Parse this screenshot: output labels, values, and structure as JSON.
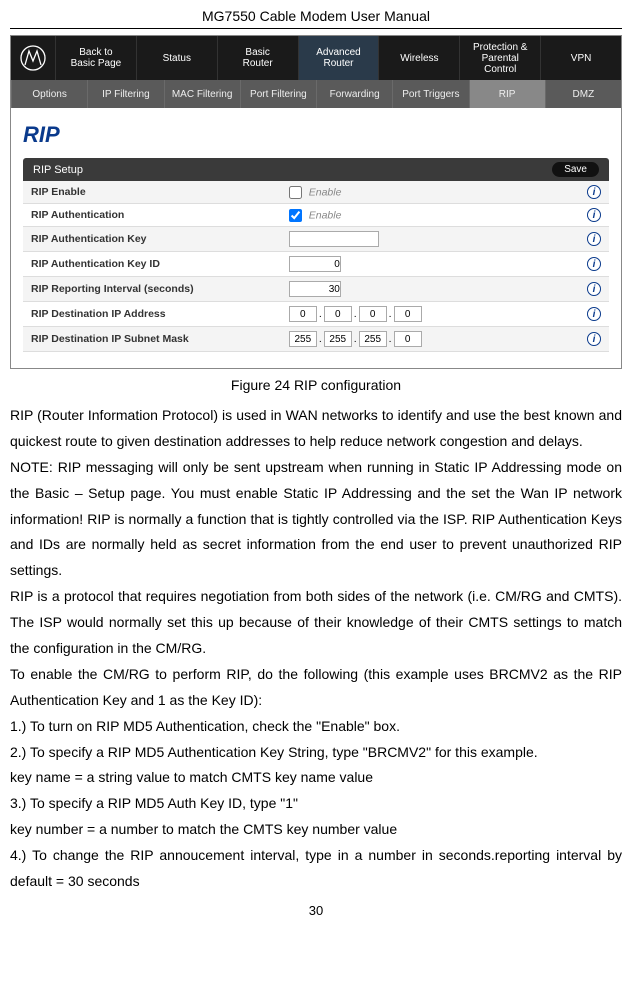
{
  "doc_title": "MG7550 Cable Modem User Manual",
  "page_number": "30",
  "nav": {
    "items": [
      "Back to\nBasic Page",
      "Status",
      "Basic\nRouter",
      "Advanced\nRouter",
      "Wireless",
      "Protection &\nParental Control",
      "VPN"
    ]
  },
  "subnav": {
    "items": [
      "Options",
      "IP Filtering",
      "MAC Filtering",
      "Port Filtering",
      "Forwarding",
      "Port Triggers",
      "RIP",
      "DMZ"
    ]
  },
  "rip": {
    "title": "RIP",
    "setup_label": "RIP Setup",
    "save_label": "Save",
    "rows": {
      "enable_label": "RIP Enable",
      "enable_text": "Enable",
      "auth_label": "RIP Authentication",
      "auth_text": "Enable",
      "key_label": "RIP Authentication Key",
      "key_value": "",
      "keyid_label": "RIP Authentication Key ID",
      "keyid_value": "0",
      "interval_label": "RIP Reporting Interval (seconds)",
      "interval_value": "30",
      "dest_ip_label": "RIP Destination IP Address",
      "dest_ip": [
        "0",
        "0",
        "0",
        "0"
      ],
      "subnet_label": "RIP Destination IP Subnet Mask",
      "subnet": [
        "255",
        "255",
        "255",
        "0"
      ]
    }
  },
  "figure_caption": "Figure 24 RIP configuration",
  "body": {
    "p1": "RIP (Router Information Protocol) is used in WAN networks to identify and use the best known and quickest route to given destination addresses to help reduce network congestion and delays.",
    "p2": "NOTE: RIP messaging will only be sent upstream when running in Static IP Addressing mode on the Basic – Setup page. You must enable Static IP Addressing and the set the Wan IP network information!  RIP is normally a function that is tightly controlled via the ISP.  RIP Authentication Keys and IDs are normally held as secret information from the end user to prevent unauthorized RIP settings.",
    "p3": "RIP is a protocol that requires negotiation from both sides of the network (i.e. CM/RG and CMTS).  The ISP would normally set this up because of their knowledge of their CMTS settings to match the configuration in the CM/RG.",
    "p4": "To enable the CM/RG to perform RIP, do the following (this example uses BRCMV2 as the RIP Authentication Key and 1 as the Key ID):",
    "p5": "1.) To turn on RIP MD5 Authentication, check the \"Enable\" box.",
    "p6": "2.) To specify a RIP MD5 Authentication Key String, type \"BRCMV2\" for this example.",
    "p7": "key name = a string value to match CMTS key name value",
    "p8": "3.) To specify a RIP MD5 Auth Key ID, type \"1\"",
    "p9": "key number = a number to match the CMTS key number value",
    "p10": "4.) To change the RIP annoucement interval, type in a number in seconds.reporting interval by default = 30 seconds"
  }
}
